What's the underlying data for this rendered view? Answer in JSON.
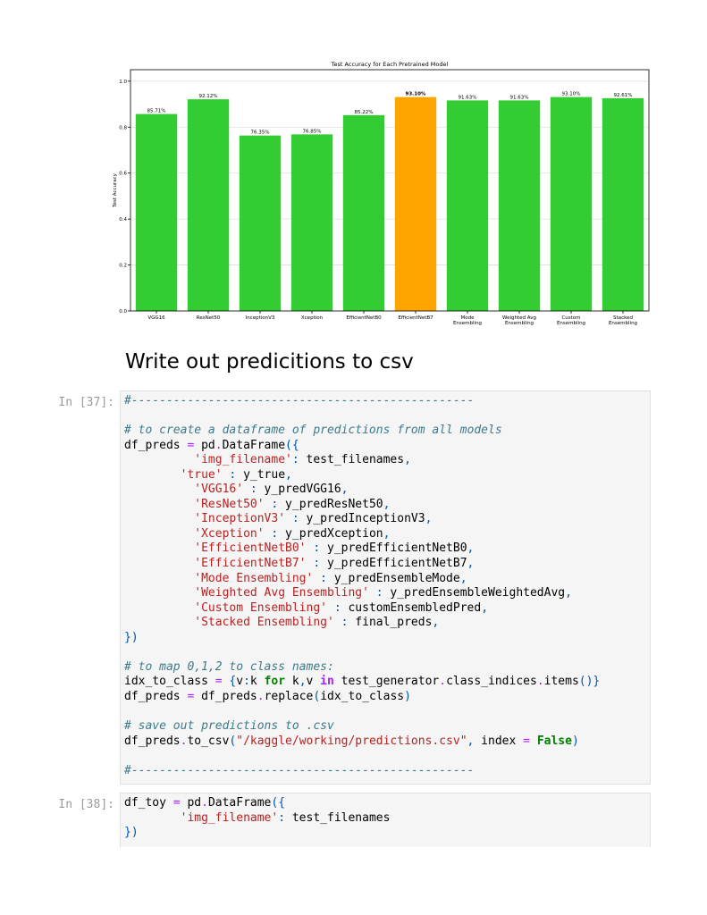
{
  "chart_data": {
    "type": "bar",
    "title": "Test Accuracy for Each Pretrained Model",
    "ylabel": "Test Accuracy",
    "xlabel": "",
    "ylim": [
      0,
      1.05
    ],
    "yticks": [
      "0.0",
      "0.2",
      "0.4",
      "0.6",
      "0.8",
      "1.0"
    ],
    "grid": true,
    "categories": [
      "VGG16",
      "ResNet50",
      "InceptionV3",
      "Xception",
      "EfficientNetB0",
      "EfficientNetB7",
      "Mode Ensembling",
      "Weighted Avg Ensembling",
      "Custom Ensembling",
      "Stacked Ensembling"
    ],
    "category_lines": [
      [
        "VGG16"
      ],
      [
        "ResNet50"
      ],
      [
        "InceptionV3"
      ],
      [
        "Xception"
      ],
      [
        "EfficientNetB0"
      ],
      [
        "EfficientNetB7"
      ],
      [
        "Mode",
        "Ensembling"
      ],
      [
        "Weighted Avg",
        "Ensembling"
      ],
      [
        "Custom",
        "Ensembling"
      ],
      [
        "Stacked",
        "Ensembling"
      ]
    ],
    "values": [
      0.8571,
      0.9212,
      0.7635,
      0.7685,
      0.8522,
      0.931,
      0.9163,
      0.9163,
      0.931,
      0.9261
    ],
    "data_labels": [
      "85.71%",
      "92.12%",
      "76.35%",
      "76.85%",
      "85.22%",
      "93.10%",
      "91.63%",
      "91.63%",
      "93.10%",
      "92.61%"
    ],
    "highlight_index": 5,
    "colors": {
      "bar": "#33cc33",
      "highlight": "#ffa500",
      "grid": "#dddddd",
      "axis": "#000000"
    }
  },
  "markdown": {
    "heading": "Write out predicitions to csv"
  },
  "cells": [
    {
      "prompt": "In [37]:"
    },
    {
      "prompt": "In [38]:"
    }
  ]
}
